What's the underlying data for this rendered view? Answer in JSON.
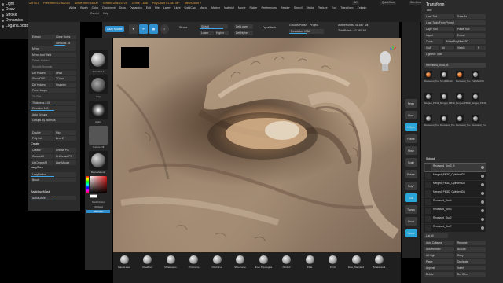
{
  "app": {
    "title": "ZBrush 2021.1.1",
    "title_segments": [
      "ZBrush 2021.1.1",
      "Oct 001",
      "Free Mem 12.862GB",
      "Active Mem 18500",
      "Scratch Disk 15729",
      "ZTime 1.688",
      "PolyCount 61.582 MP",
      "MeshCount 7"
    ],
    "right_tags": [
      "AC",
      "QuickSave",
      "See-through 0",
      "Menus",
      "DefaultZScript"
    ]
  },
  "menus": {
    "row1": [
      "Alpha",
      "Brush",
      "Color",
      "Document",
      "Draw",
      "Dynamics",
      "Edit",
      "File",
      "Layer",
      "Light",
      "LightCap",
      "Macro",
      "Marker",
      "Material",
      "Movie",
      "Picker",
      "Preferences",
      "Render",
      "Stencil",
      "Stroke",
      "Texture",
      "Tool",
      "Transform",
      "Zplugin",
      "Zscript",
      "Help"
    ],
    "row2": [
      "Zscript",
      "Help"
    ]
  },
  "left_tray": {
    "items": [
      "Light",
      "Draw",
      "Stroke",
      "Dynamics",
      "LogantLoodBox"
    ],
    "hint": "0.192, 0.717, 0.168"
  },
  "tool_row": {
    "lazy_mouse": "Lazy Mouse",
    "draw_mode_icons": [
      "sphere-icon",
      "sun-icon",
      "grid-icon"
    ],
    "stroke_label": "Stroke",
    "sdiv": "SDiv 6",
    "sdiv_btns": [
      "Lower Res",
      "Higher Res"
    ],
    "del_btns": [
      "Del Lower",
      "Del Higher"
    ],
    "dynamesh": "DynaMesh",
    "groups_polish": "Groups Polish",
    "project": "Project",
    "active_points": "ActivePoints: 41.687 Mil",
    "total_points": "TotalPoints: 62.297 Mil",
    "resolution": "Resolution 1984"
  },
  "left_panel": {
    "rows": [
      "Extract",
      "Close Holes",
      "WeldPoints",
      "WeldDist 18",
      "Mirror",
      "Mirror And Weld",
      "Delete Hidden",
      "Smooth Normals",
      "Del Hidden",
      "Undo",
      "Show/OFF",
      "ZColor",
      "Del Hidden",
      "Sharpen",
      "Panel Loops",
      "Tic Flat",
      "Thickness 4.00",
      "Elevation 100",
      "Auto Groups",
      "Groups By Normals",
      "Double",
      "Flip",
      "Poly Loft",
      "Zero Z",
      "Create",
      "Crease",
      "Crease PG",
      "CreaseAll",
      "UnCrease PG",
      "UnCreaseAll",
      "LazyMouse",
      "LazyStep",
      "LazyRadius",
      "Brush",
      "BackfaceMask",
      "AccuCurve"
    ],
    "heading_extract": "Extract",
    "heading_create": "Create",
    "heading_lazy": "LazyMouse",
    "heading_brush": "Brush",
    "gizmo_label": "UndoSmooth 4"
  },
  "shelf": {
    "thumbs": [
      "Sketch_Standard 2",
      "ClayBuildup",
      "BrushAlpha",
      "Texture Off",
      "Zbru Matl_MODEL",
      "SwitchColor",
      "FillObject",
      "Alternate"
    ],
    "caps": [
      "Standard 2",
      "Clay",
      "Alpha",
      "Texture Off",
      "BasicMaterial"
    ],
    "color_btns": [
      "SwitchColor",
      "FillObject",
      "Alternate"
    ]
  },
  "canvas": {
    "gizmo_axes": [
      "X",
      "Y",
      "Z"
    ]
  },
  "brushes": [
    "SelectLasso",
    "MaskPen",
    "MaskLasso",
    "TrimCurve",
    "ClipCurve",
    "SliceCurve",
    "Move Topologica",
    "hPolish",
    "Inflat",
    "Pinch",
    "Dam_Standard",
    "SnakeHook"
  ],
  "right_shelf": {
    "buttons": [
      "Persp",
      "Floor",
      "L.Sym",
      "Frame",
      "Move",
      "Scale",
      "Rotate",
      "PolyF",
      "Solo",
      "Transp",
      "Ghost",
      "Xpose"
    ]
  },
  "right_panel": {
    "title": "Transform",
    "subtitle": "Tool",
    "buttons": [
      "Load Tool",
      "Save As",
      "Load Tools From Project",
      "Copy Tool",
      "Paste Tool",
      "Import",
      "Export",
      "Clone",
      "Make PolyMesh3D",
      "GoZ",
      "All",
      "Visible",
      "R",
      "Lightbox Tools"
    ],
    "tool_name": "Recessed_Tool3_B",
    "tiles": [
      "Recessed_Tool3",
      "SimpleBrush",
      "Recessed_Tool0",
      "PolyMesh3D",
      "Merged_PM3D_Cylinder3D2",
      "Merged_PM3D_Cylinder3D3",
      "Merged_PM3D_Cylinder3D4",
      "Merged_PM3D_Cylinder3D",
      "Recessed_Tool4",
      "Recessed_Tool2",
      "Recessed_Tool7",
      "Recessed_Tool1"
    ],
    "subtool_heading": "Subtool",
    "subtools": [
      "Recessed_Tool3_B",
      "Merged_PM3D_Cylinder3D2",
      "Merged_PM3D_Cylinder3D3",
      "Merged_PM3D_Cylinder3D4",
      "Recessed_Tool4",
      "Recessed_Tool3",
      "Recessed_Tool2",
      "Recessed_Tool7"
    ],
    "list_all": "List All",
    "bottom_btns": [
      "Auto Collapse",
      "Rename",
      "AutoReorder",
      "All Low",
      "All High",
      "Copy",
      "Paste",
      "Duplicate",
      "Append",
      "Insert",
      "Delete",
      "Del Other"
    ]
  },
  "colors": {
    "accent": "#2f8fcf",
    "highlight_cyan": "#2aa7d8",
    "panel_bg": "#2b2b2b",
    "title_orange": "#e0a040"
  }
}
